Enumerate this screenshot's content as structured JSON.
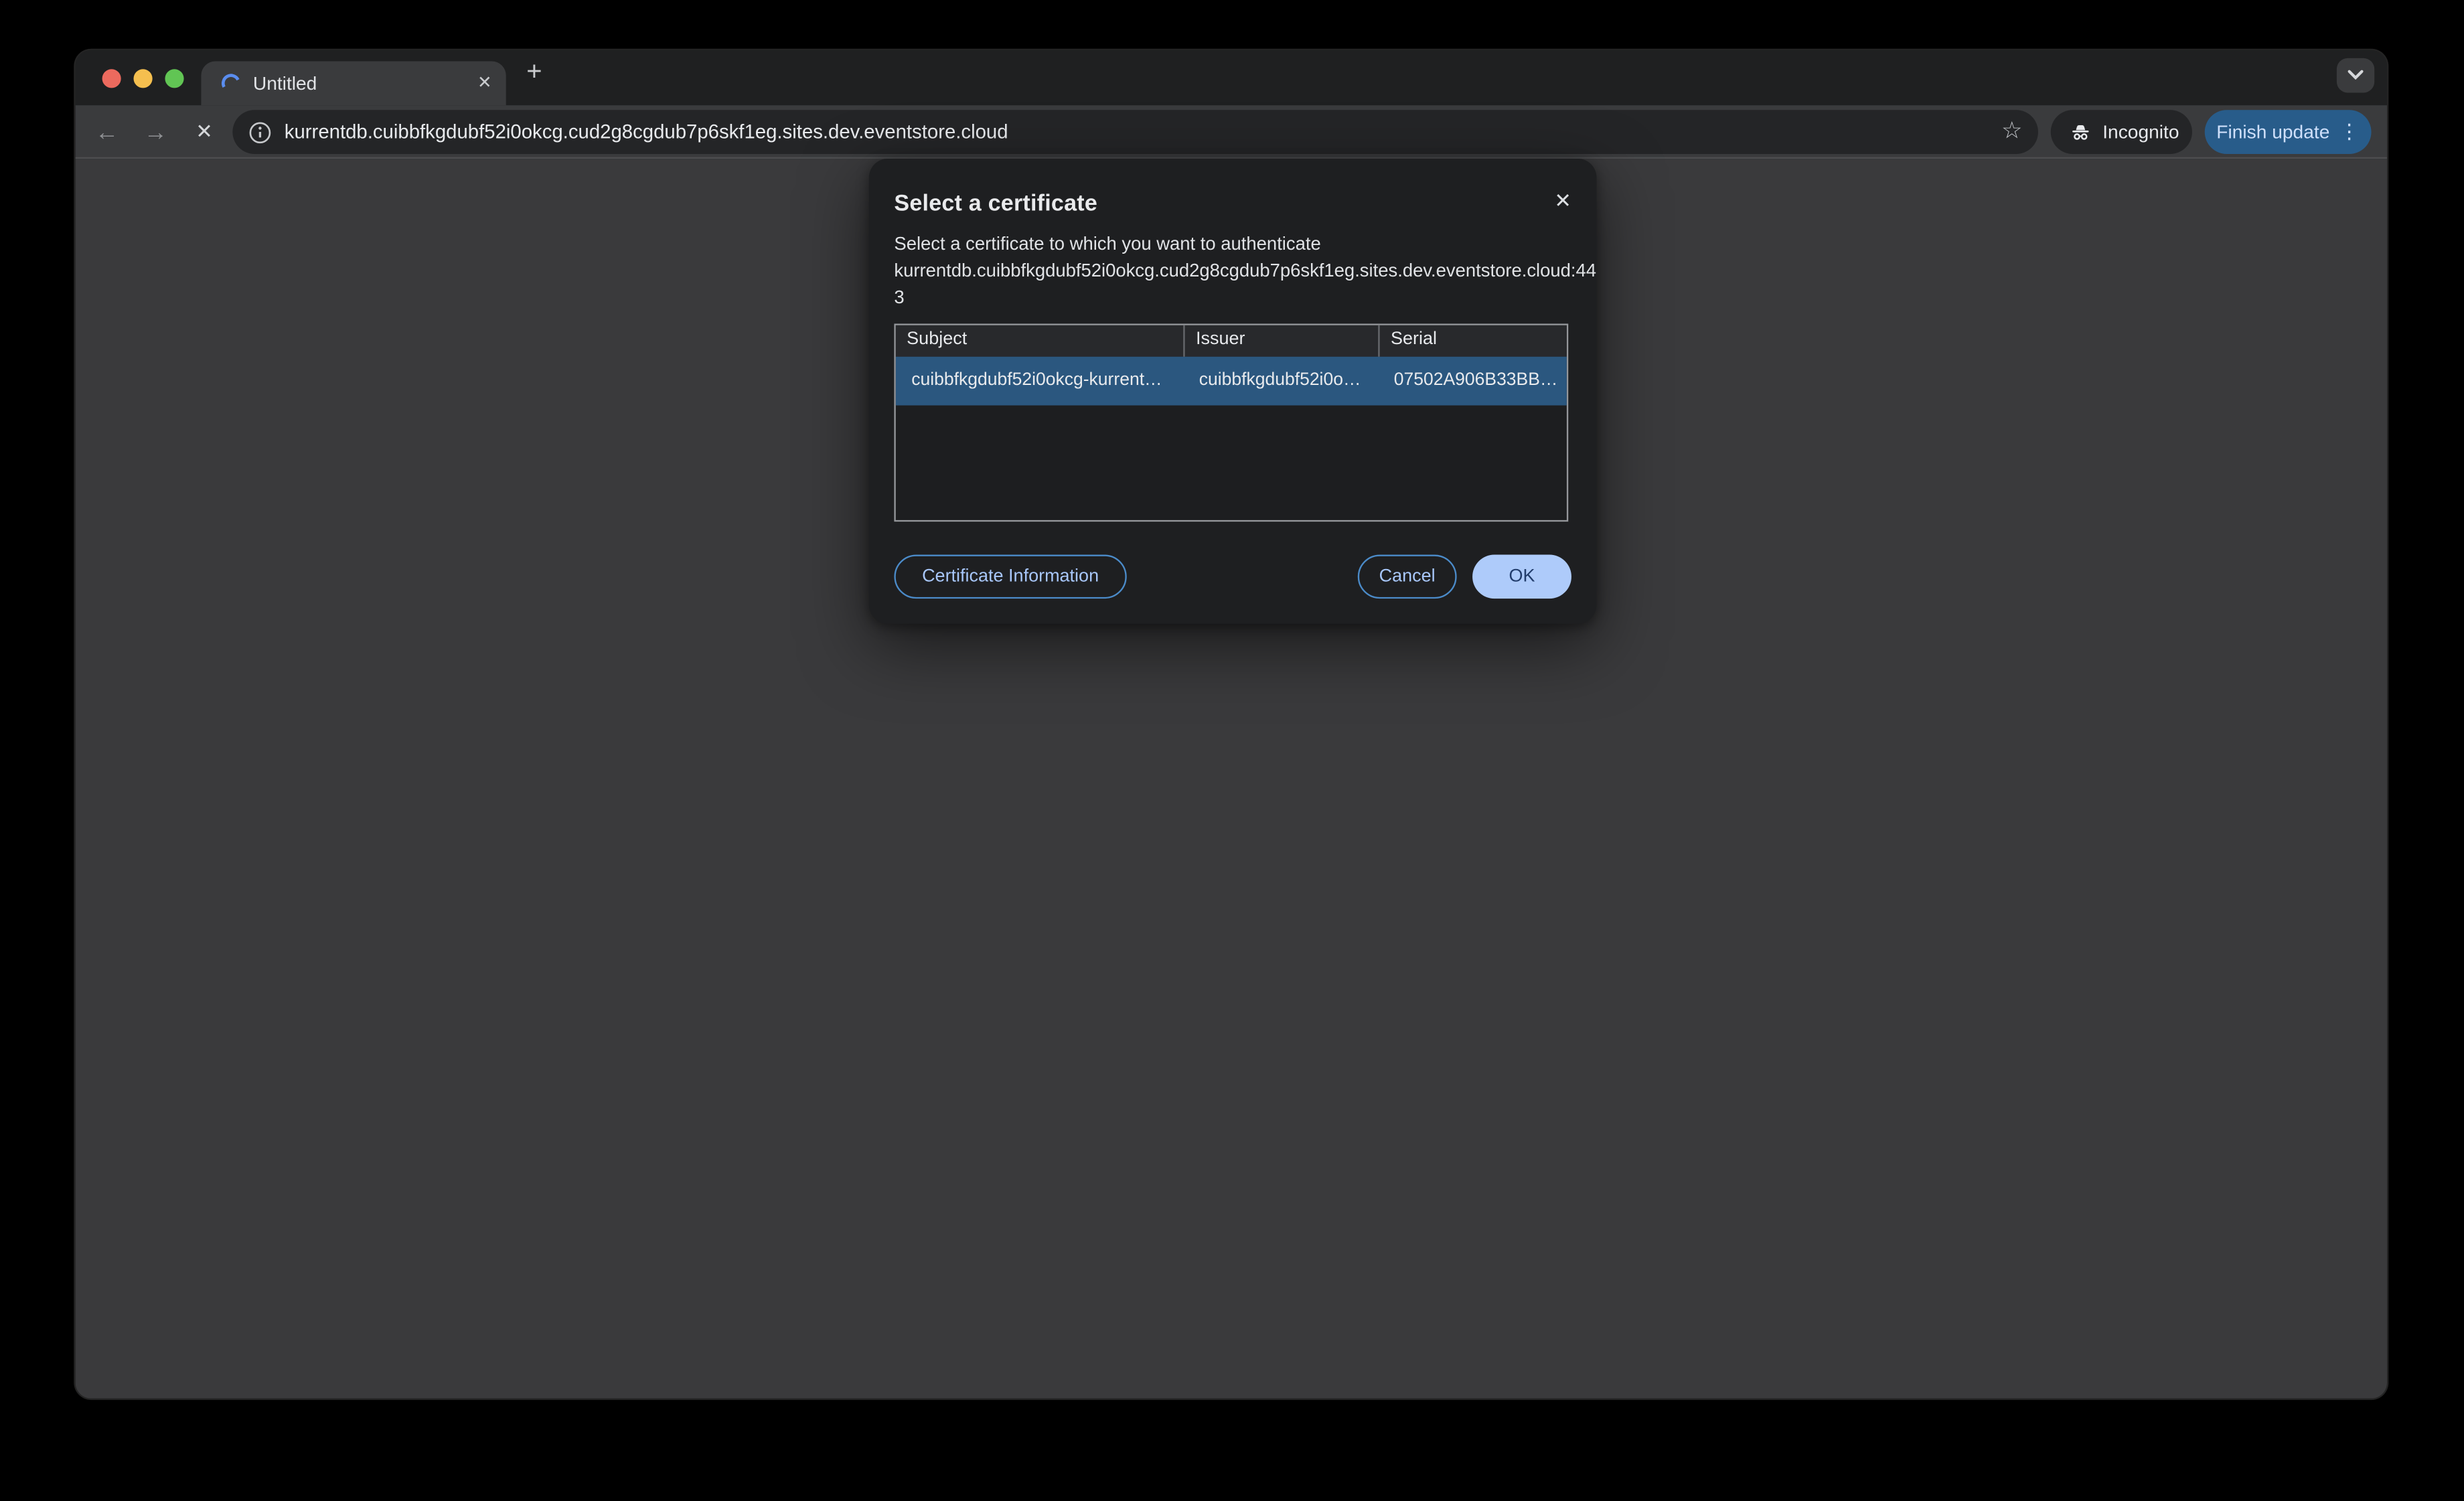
{
  "browser": {
    "tab": {
      "title": "Untitled"
    },
    "toolbar": {
      "url": "kurrentdb.cuibbfkgdubf52i0okcg.cud2g8cgdub7p6skf1eg.sites.dev.eventstore.cloud",
      "incognito_label": "Incognito",
      "update_label": "Finish update"
    }
  },
  "icons": {
    "back": "←",
    "forward": "→",
    "stop": "✕",
    "new_tab": "+",
    "tab_close": "✕",
    "dialog_close": "✕",
    "star": "☆",
    "menu_dots": "⋮"
  },
  "dialog": {
    "title": "Select a certificate",
    "description": "Select a certificate to which you want to authenticate kurrentdb.cuibbfkgdubf52i0okcg.cud2g8cgdub7p6skf1eg.sites.dev.eventstore.cloud:443",
    "description_lines": [
      "Select a certificate to which you want to authenticate",
      "kurrentdb.cuibbfkgdubf52i0okcg.cud2g8cgdub7p6skf1eg.sites.dev.eventstore.cloud:44",
      "3"
    ],
    "table": {
      "columns": [
        "Subject",
        "Issuer",
        "Serial"
      ],
      "rows": [
        {
          "subject": "cuibbfkgdubf52i0okcg-kurrent…",
          "issuer": "cuibbfkgdubf52i0o…",
          "serial": "07502A906B33BB…"
        }
      ]
    },
    "buttons": {
      "certificate_information": "Certificate Information",
      "cancel": "Cancel",
      "ok": "OK"
    }
  },
  "colors": {
    "selected_row": "#2b577f",
    "accent_blue_text": "#a8c7fa",
    "ok_fill": "#aecbfa",
    "update_pill": "#285c8a",
    "dialog_bg": "#1e1f21",
    "toolbar_bg": "#3a3b3d",
    "tabstrip_bg": "#1f2021",
    "omnibox_bg": "#242527",
    "page_bg": "#3a3a3c"
  }
}
